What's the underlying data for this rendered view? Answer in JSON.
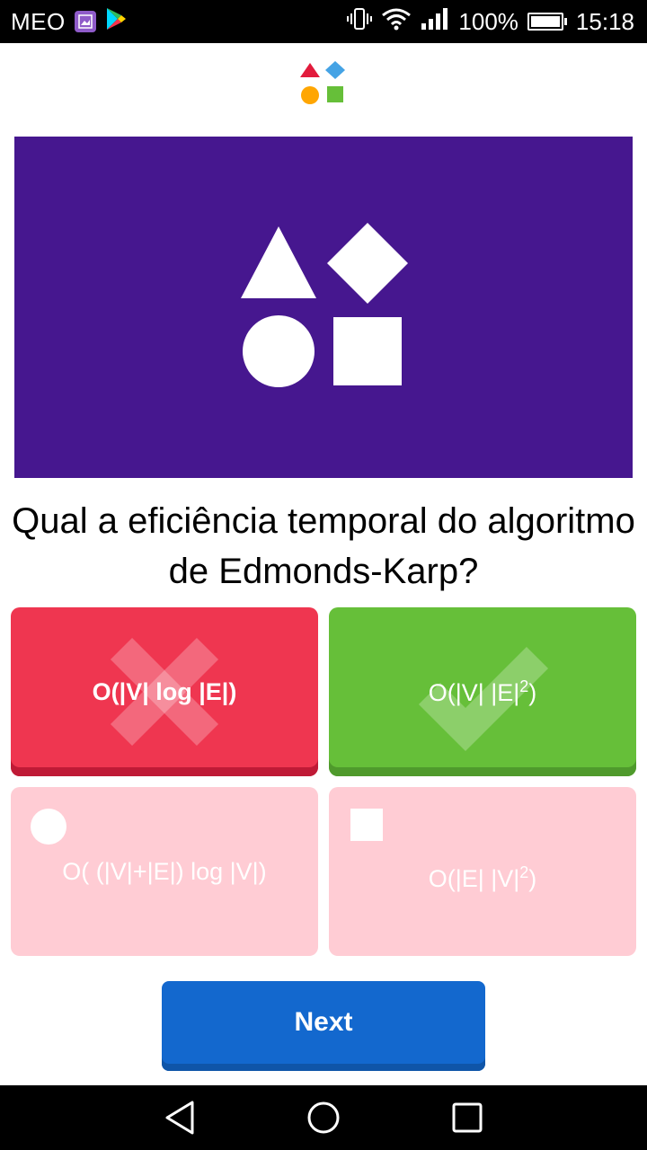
{
  "status_bar": {
    "carrier": "MEO",
    "battery_text": "100%",
    "time": "15:18",
    "icons": [
      "gallery-icon",
      "play-store-icon",
      "vibrate-icon",
      "wifi-icon",
      "signal-icon",
      "battery-icon"
    ]
  },
  "header": {
    "logo_icon": "shapes-logo-icon"
  },
  "hero": {
    "background": "#46178f",
    "icon": "shapes-icon"
  },
  "question": {
    "text": "Qual a eficiência temporal do algoritmo de Edmonds-Karp?"
  },
  "answers": [
    {
      "shape": "triangle",
      "text": "O(|V| log |E|)",
      "state": "incorrect",
      "color": "#e21b3c",
      "overlay_icon": "cross-icon"
    },
    {
      "shape": "diamond",
      "text": "O(|V| |E|",
      "sup": "2",
      "suffix": ")",
      "state": "correct",
      "color": "#66bf39",
      "overlay_icon": "check-icon"
    },
    {
      "shape": "circle",
      "text": "O( (|V|+|E|) log |V|)",
      "state": "faded",
      "color": "#ffccd4",
      "overlay_icon": "circle-icon"
    },
    {
      "shape": "square",
      "text": "O(|E| |V|",
      "sup": "2",
      "suffix": ")",
      "state": "faded",
      "color": "#ffccd4",
      "overlay_icon": "square-icon"
    }
  ],
  "next_button": {
    "label": "Next",
    "color": "#1368ce"
  },
  "nav_bar": {
    "icons": [
      "back-icon",
      "home-icon",
      "recents-icon"
    ]
  }
}
